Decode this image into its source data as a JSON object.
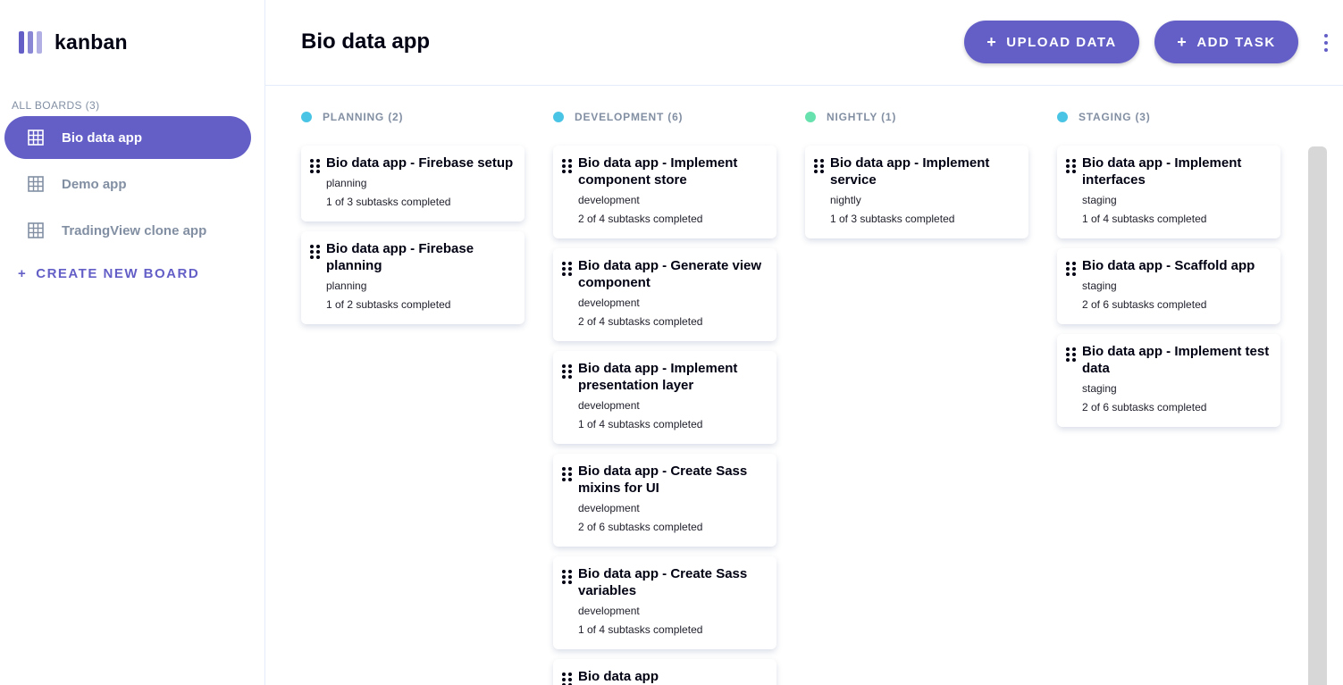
{
  "sidebar": {
    "logo_text": "kanban",
    "boards_heading": "ALL BOARDS (3)",
    "boards": [
      {
        "label": "Bio data app",
        "active": true
      },
      {
        "label": "Demo app",
        "active": false
      },
      {
        "label": "TradingView clone app",
        "active": false
      }
    ],
    "create_board": {
      "icon": "+",
      "label": "CREATE NEW BOARD"
    }
  },
  "header": {
    "title": "Bio data app",
    "upload_button": {
      "icon": "+",
      "label": "UPLOAD DATA"
    },
    "add_task_button": {
      "icon": "+",
      "label": "ADD TASK"
    },
    "menu_icon": "vertical-ellipsis-icon"
  },
  "colors": {
    "accent": "#635fc7",
    "planning": "#49c4e5",
    "development": "#49c4e5",
    "nightly": "#67e2ae",
    "staging": "#49c4e5"
  },
  "columns": [
    {
      "heading": "PLANNING (2)",
      "cards": [
        {
          "title": "Bio data app - Firebase setup",
          "status": "planning",
          "subtasks": "1 of 3 subtasks completed"
        },
        {
          "title": "Bio data app - Firebase planning",
          "status": "planning",
          "subtasks": "1 of 2 subtasks completed"
        }
      ]
    },
    {
      "heading": "DEVELOPMENT (6)",
      "cards": [
        {
          "title": "Bio data app - Implement component store",
          "status": "development",
          "subtasks": "2 of 4 subtasks completed"
        },
        {
          "title": "Bio data app - Generate view component",
          "status": "development",
          "subtasks": "2 of 4 subtasks completed"
        },
        {
          "title": "Bio data app - Implement presentation layer",
          "status": "development",
          "subtasks": "1 of 4 subtasks completed"
        },
        {
          "title": "Bio data app - Create Sass mixins for UI",
          "status": "development",
          "subtasks": "2 of 6 subtasks completed"
        },
        {
          "title": "Bio data app - Create Sass variables",
          "status": "development",
          "subtasks": "1 of 4 subtasks completed"
        },
        {
          "title": "Bio data app",
          "status": "",
          "subtasks": ""
        }
      ]
    },
    {
      "heading": "NIGHTLY (1)",
      "cards": [
        {
          "title": "Bio data app - Implement service",
          "status": "nightly",
          "subtasks": "1 of 3 subtasks completed"
        }
      ]
    },
    {
      "heading": "STAGING (3)",
      "cards": [
        {
          "title": "Bio data app - Implement interfaces",
          "status": "staging",
          "subtasks": "1 of 4 subtasks completed"
        },
        {
          "title": "Bio data app - Scaffold app",
          "status": "staging",
          "subtasks": "2 of 6 subtasks completed"
        },
        {
          "title": "Bio data app - Implement test data",
          "status": "staging",
          "subtasks": "2 of 6 subtasks completed"
        }
      ]
    }
  ]
}
